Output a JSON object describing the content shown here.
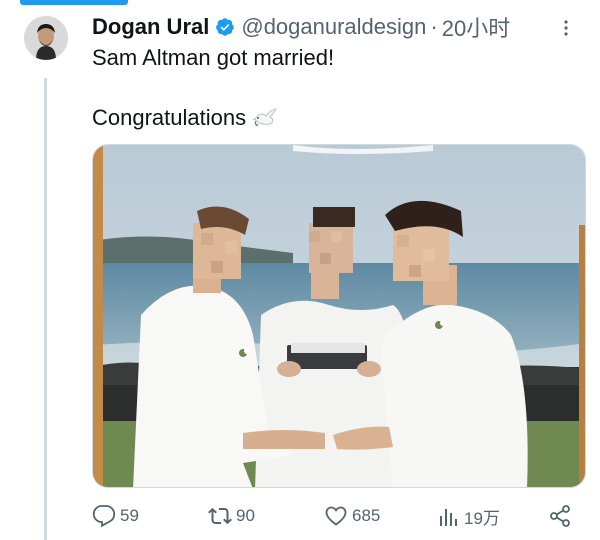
{
  "author": {
    "display_name": "Dogan Ural",
    "handle": "@doganuraldesign",
    "separator": "·",
    "timestamp": "20小时",
    "verified": true,
    "verified_icon": "verified-badge-icon",
    "avatar_icon": "avatar-photo"
  },
  "tweet": {
    "line1": "Sam Altman got married!",
    "line2": "Congratulations",
    "emoji_icon": "dove-emoji-icon"
  },
  "media": {
    "description_icon": "wedding-photo"
  },
  "actions": {
    "replies": "59",
    "retweets": "90",
    "likes": "685",
    "views": "19万"
  },
  "colors": {
    "accent": "#1d9bf0",
    "text_primary": "#0f1419",
    "text_secondary": "#536471",
    "border": "#cfd9de"
  }
}
